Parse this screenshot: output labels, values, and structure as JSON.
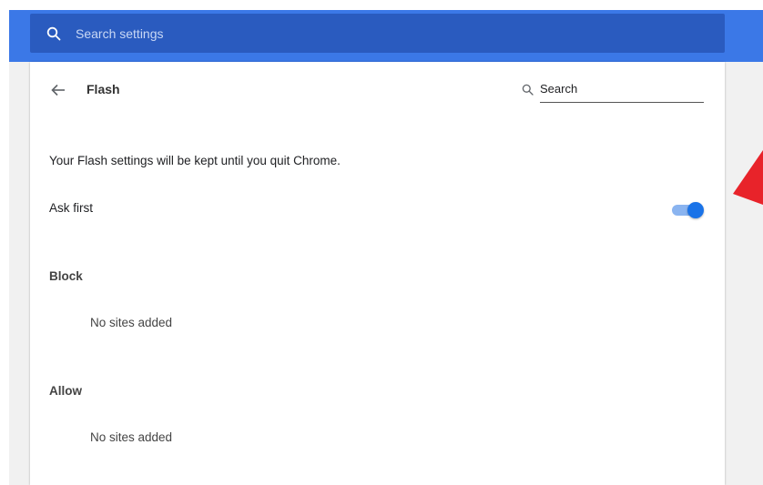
{
  "colors": {
    "header_blue": "#3b78e7",
    "search_bar_blue": "#2a5bbf",
    "toggle_on": "#1a73e8",
    "annotation_red": "#e8232a"
  },
  "header": {
    "search_placeholder": "Search settings",
    "search_icon": "search-icon"
  },
  "page": {
    "title": "Flash",
    "back_icon": "arrow-left-icon",
    "search_label": "Search",
    "search_icon": "search-icon",
    "notice": "Your Flash settings will be kept until you quit Chrome.",
    "ask_first": {
      "label": "Ask first",
      "enabled": true
    },
    "block": {
      "heading": "Block",
      "empty_text": "No sites added"
    },
    "allow": {
      "heading": "Allow",
      "empty_text": "No sites added"
    }
  }
}
